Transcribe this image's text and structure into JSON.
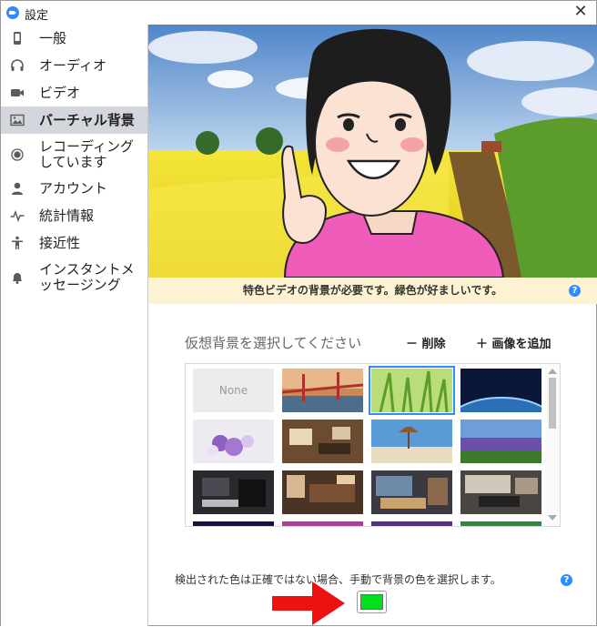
{
  "window": {
    "title": "設定",
    "close_glyph": "✕"
  },
  "sidebar": {
    "items": [
      {
        "label": "一般",
        "icon": "phone-icon"
      },
      {
        "label": "オーディオ",
        "icon": "headphones-icon"
      },
      {
        "label": "ビデオ",
        "icon": "video-camera-icon"
      },
      {
        "label": "バーチャル背景",
        "icon": "image-icon",
        "active": true
      },
      {
        "label": "レコーディングしています",
        "icon": "record-icon"
      },
      {
        "label": "アカウント",
        "icon": "user-icon"
      },
      {
        "label": "統計情報",
        "icon": "pulse-icon"
      },
      {
        "label": "接近性",
        "icon": "accessibility-icon"
      },
      {
        "label": "インスタントメッセージング",
        "icon": "bell-icon"
      }
    ]
  },
  "notice": {
    "text": "特色ビデオの背景が必要です。緑色が好ましいです。",
    "help": "?"
  },
  "gallery": {
    "label": "仮想背景を選択してください",
    "remove_label": "－ 削除",
    "add_label": "＋ 画像を追加",
    "none_label": "None",
    "selected_index": 2
  },
  "color": {
    "hint": "検出された色は正確ではない場合、手動で背景の色を選択します。",
    "help": "?",
    "selected_color": "#00e01f"
  },
  "colors": {
    "accent": "#2d8cff",
    "arrow": "#ee1111",
    "notice_bg": "#fdf3d2",
    "active_nav": "#d3d6dc"
  }
}
